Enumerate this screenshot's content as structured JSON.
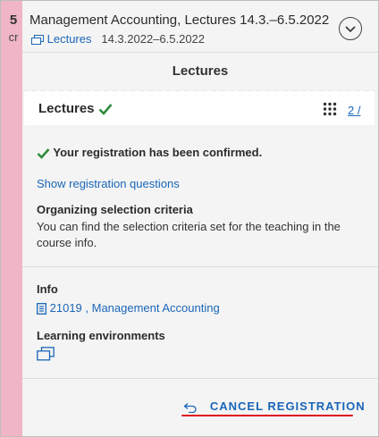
{
  "course": {
    "credits": "5",
    "credits_unit": "cr",
    "title": "Management Accounting, Lectures 14.3.–6.5.2022",
    "type_link": "Lectures",
    "dates": "14.3.2022–6.5.2022"
  },
  "section": {
    "heading": "Lectures"
  },
  "group": {
    "title": "Lectures",
    "count": "2 /"
  },
  "registration": {
    "confirmed_text": "Your registration has been confirmed.",
    "show_questions": "Show registration questions",
    "criteria_title": "Organizing selection criteria",
    "criteria_text": "You can find the selection criteria set for the teaching in the course info."
  },
  "info": {
    "title": "Info",
    "course_link": "21019 , Management Accounting"
  },
  "learning_env": {
    "title": "Learning environments"
  },
  "actions": {
    "cancel_label": "CANCEL REGISTRATION"
  },
  "colors": {
    "credit_band": "#f0b6c6",
    "link": "#1a66b8",
    "check": "#2e8b3d",
    "highlight": "#e0141e"
  }
}
